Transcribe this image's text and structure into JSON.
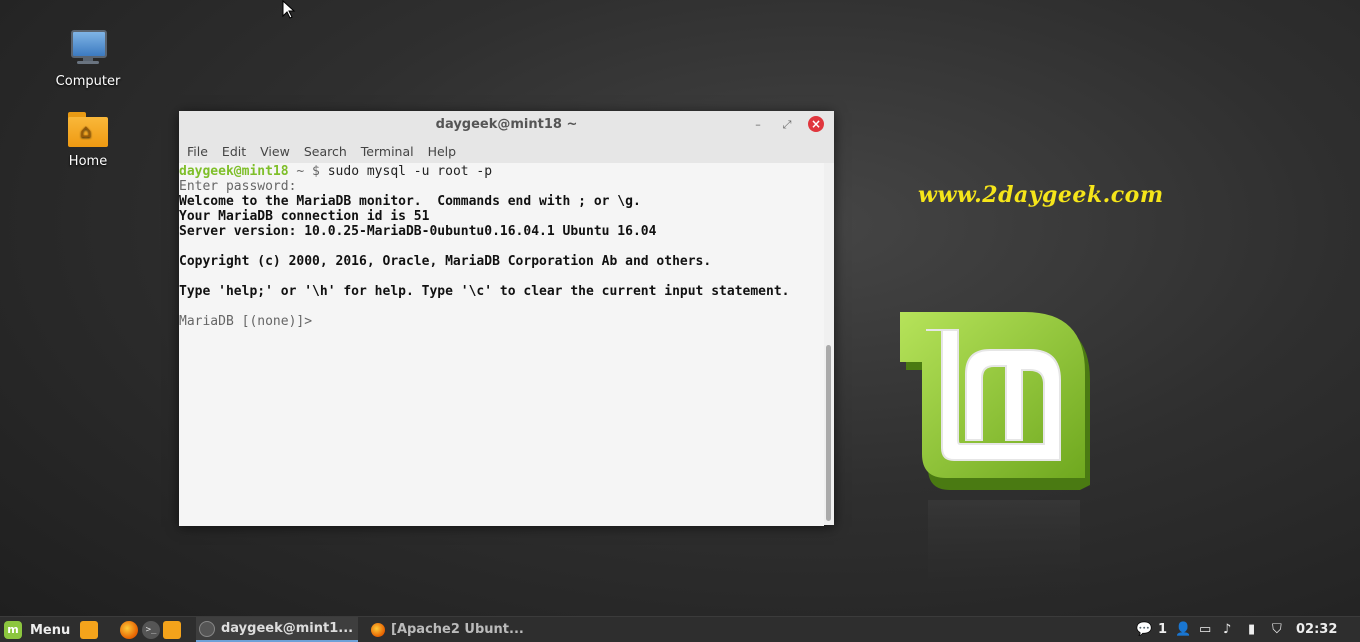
{
  "desktop": {
    "icons": [
      {
        "label": "Computer"
      },
      {
        "label": "Home"
      }
    ],
    "watermark": "www.2daygeek.com"
  },
  "terminal": {
    "title": "daygeek@mint18 ~",
    "menu": [
      "File",
      "Edit",
      "View",
      "Search",
      "Terminal",
      "Help"
    ],
    "prompt_user": "daygeek@mint18",
    "prompt_sep": " ~ $ ",
    "command": "sudo mysql -u root -p",
    "lines": [
      "Enter password:",
      "Welcome to the MariaDB monitor.  Commands end with ; or \\g.",
      "Your MariaDB connection id is 51",
      "Server version: 10.0.25-MariaDB-0ubuntu0.16.04.1 Ubuntu 16.04",
      "",
      "Copyright (c) 2000, 2016, Oracle, MariaDB Corporation Ab and others.",
      "",
      "Type 'help;' or '\\h' for help. Type '\\c' to clear the current input statement.",
      "",
      "MariaDB [(none)]>"
    ]
  },
  "taskbar": {
    "menu_label": "Menu",
    "tasks": [
      {
        "label": "daygeek@mint1..."
      },
      {
        "label": "[Apache2 Ubunt..."
      }
    ],
    "tray": {
      "notification_count": "1",
      "clock": "02:32"
    }
  },
  "colors": {
    "prompt_green": "#7fbf2a",
    "watermark_yellow": "#f5e51a",
    "close_red": "#e0363d",
    "mint_green": "#8cc63f"
  }
}
